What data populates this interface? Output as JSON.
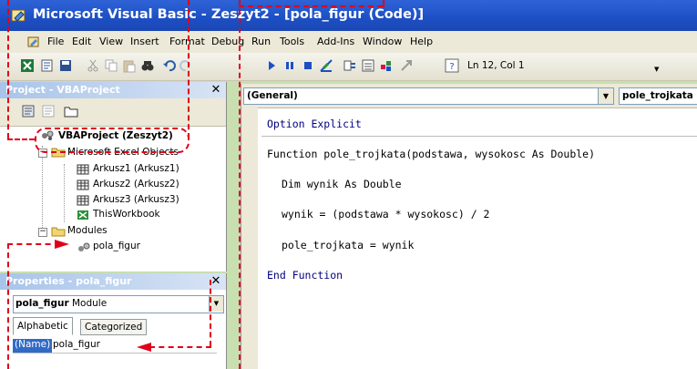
{
  "window": {
    "title": "Microsoft Visual Basic - Zeszyt2 - [pola_figur (Code)]"
  },
  "menu": [
    "File",
    "Edit",
    "View",
    "Insert",
    "Format",
    "Debug",
    "Run",
    "Tools",
    "Add-Ins",
    "Window",
    "Help"
  ],
  "toolbar": {
    "position": "Ln 12, Col 1"
  },
  "project_panel": {
    "title": "Project - VBAProject",
    "root": "VBAProject (Zeszyt2)",
    "folders": [
      {
        "name": "Microsoft Excel Objects",
        "items": [
          "Arkusz1 (Arkusz1)",
          "Arkusz2 (Arkusz2)",
          "Arkusz3 (Arkusz3)",
          "ThisWorkbook"
        ]
      },
      {
        "name": "Modules",
        "items": [
          "pola_figur"
        ]
      }
    ]
  },
  "properties_panel": {
    "title": "Properties - pola_figur",
    "object_name": "pola_figur",
    "object_type": "Module",
    "tabs": [
      "Alphabetic",
      "Categorized"
    ],
    "prop_name": "(Name)",
    "prop_value": "pola_figur"
  },
  "code_window": {
    "object_combo": "(General)",
    "proc_combo": "pole_trojkata",
    "lines": [
      "Option Explicit",
      "Function pole_trojkata(podstawa, wysokosc As Double)",
      "Dim wynik As Double",
      "wynik = (podstawa * wysokosc) / 2",
      "pole_trojkata = wynik",
      "End Function"
    ]
  },
  "colors": {
    "callout": "#e0001a",
    "title_bar": "#1d4fc4",
    "keyword": "#00007f"
  }
}
